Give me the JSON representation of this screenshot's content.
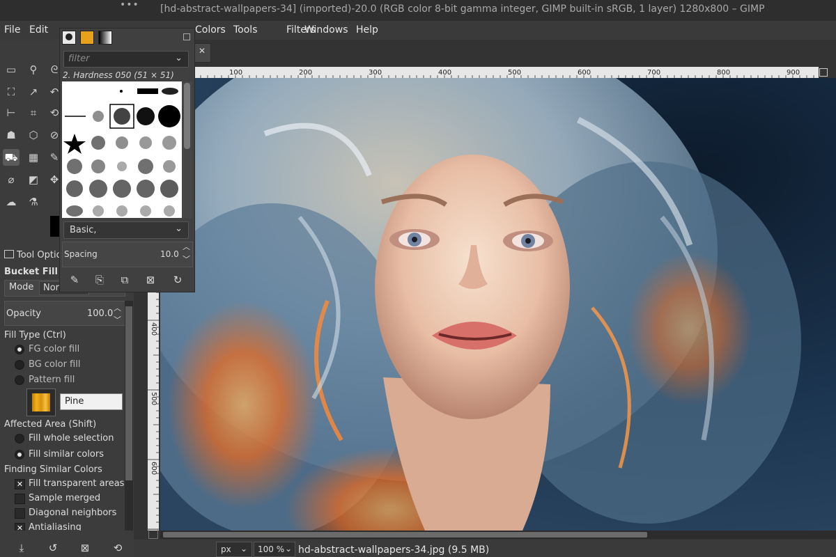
{
  "window": {
    "title": "[hd-abstract-wallpapers-34] (imported)-20.0 (RGB color 8-bit gamma integer, GIMP built-in sRGB, 1 layer) 1280x800 – GIMP"
  },
  "menubar": {
    "items": [
      "File",
      "Edit",
      "Colors",
      "Tools",
      "Filters",
      "Windows",
      "Help"
    ]
  },
  "brushes": {
    "filter_placeholder": "filter",
    "selected_name": "2. Hardness 050 (51 × 51)",
    "set": "Basic,",
    "spacing_label": "Spacing",
    "spacing_value": "10.0"
  },
  "tool_options": {
    "panel_title": "Tool Options",
    "tool_name": "Bucket Fill",
    "mode_label": "Mode",
    "mode_value": "Nor",
    "opacity_label": "Opacity",
    "opacity_value": "100.0",
    "fill_type_label": "Fill Type  (Ctrl)",
    "fill_type_options": [
      {
        "label": "FG color fill",
        "selected": true
      },
      {
        "label": "BG color fill",
        "selected": false
      },
      {
        "label": "Pattern fill",
        "selected": false
      }
    ],
    "pattern_name": "Pine",
    "affected_area_label": "Affected Area  (Shift)",
    "affected_area_options": [
      {
        "label": "Fill whole selection",
        "selected": false
      },
      {
        "label": "Fill similar colors",
        "selected": true
      }
    ],
    "finding_similar_label": "Finding Similar Colors",
    "checks": [
      {
        "label": "Fill transparent areas",
        "checked": true
      },
      {
        "label": "Sample merged",
        "checked": false
      },
      {
        "label": "Diagonal neighbors",
        "checked": false
      },
      {
        "label": "Antialiasing",
        "checked": true
      }
    ]
  },
  "ruler": {
    "h_labels": [
      "100",
      "200",
      "300",
      "400",
      "500",
      "600",
      "700",
      "800",
      "900"
    ],
    "v_labels": [
      "400",
      "500",
      "600"
    ]
  },
  "status": {
    "unit": "px",
    "zoom": "100 %",
    "file_info": "hd-abstract-wallpapers-34.jpg (9.5 MB)"
  }
}
